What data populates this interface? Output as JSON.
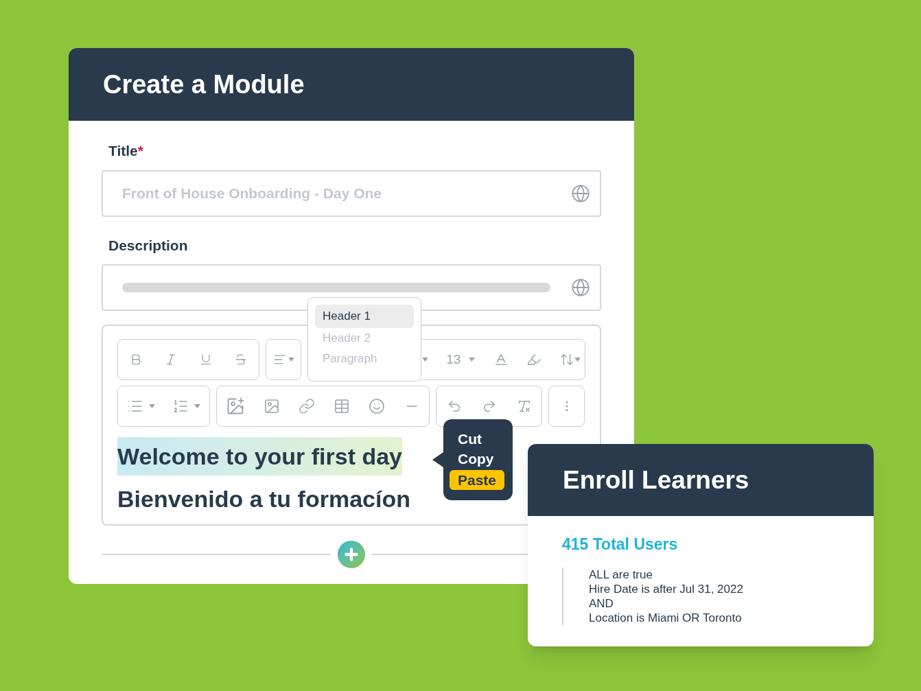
{
  "create_module": {
    "title": "Create a Module",
    "fields": [
      {
        "kind": "input",
        "label": "Title",
        "required_mark": "*",
        "placeholder": "Front of House Onboarding - Day One"
      },
      {
        "kind": "textarea",
        "label": "Description"
      }
    ],
    "format_menu": [
      {
        "label": "Header 1",
        "selected": true
      },
      {
        "label": "Header 2",
        "selected": false
      },
      {
        "label": "Paragraph",
        "selected": false
      }
    ],
    "font_size": "13",
    "editor_lines": [
      {
        "text": "Welcome to your first day",
        "selected": true
      },
      {
        "text": "Bienvenido a tu formacíon",
        "selected": false
      }
    ],
    "context_menu": [
      {
        "label": "Cut",
        "selected": false
      },
      {
        "label": "Copy",
        "selected": false
      },
      {
        "label": "Paste",
        "selected": true
      }
    ]
  },
  "enroll": {
    "title": "Enroll Learners",
    "total": "415 Total Users",
    "rules": [
      "ALL are true",
      "Hire Date is after Jul 31, 2022",
      "AND",
      "Location is Miami OR Toronto"
    ]
  }
}
